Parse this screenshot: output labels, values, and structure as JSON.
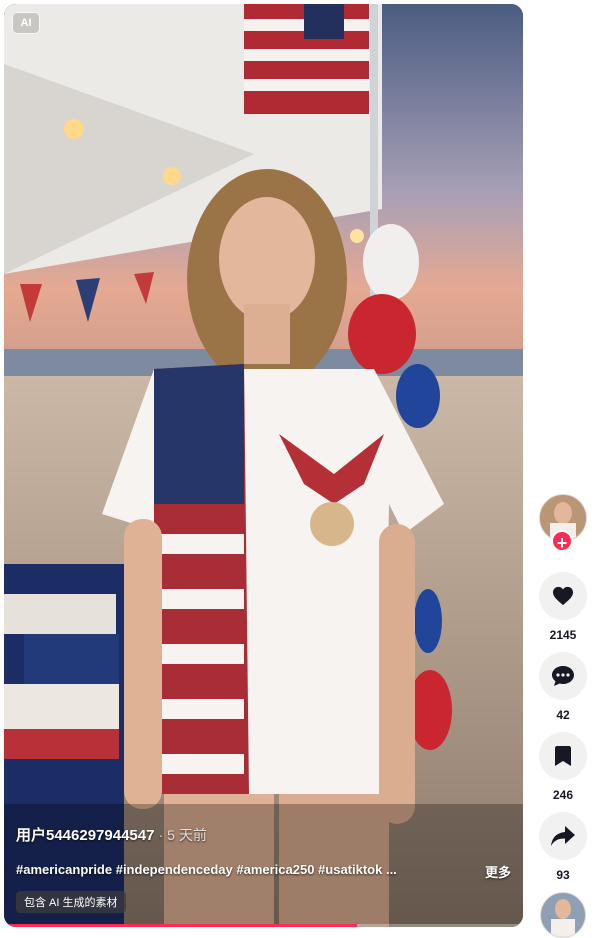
{
  "video": {
    "ai_badge": "AI",
    "username": "用户5446297944547",
    "time_ago": "· 5 天前",
    "hashtags": "#americanpride #independenceday #america250 #usatiktok ...",
    "more_label": "更多",
    "ai_content_label": "包含 AI 生成的素材",
    "progress": 0.68
  },
  "actions": {
    "likes": "2145",
    "comments": "42",
    "saves": "246",
    "shares": "93"
  },
  "colors": {
    "accent": "#fe2c55",
    "action_bg": "#f1f1f2"
  }
}
